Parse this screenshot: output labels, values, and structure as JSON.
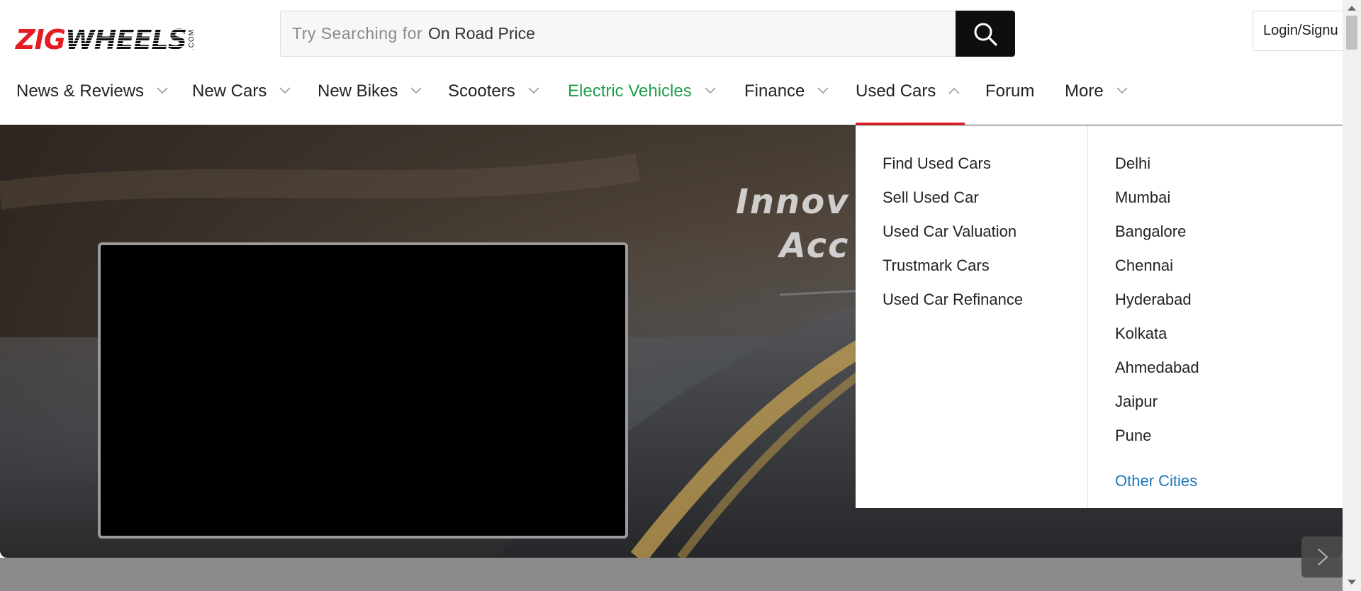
{
  "brand": {
    "logo_text_red": "ZIG",
    "logo_text_black": "WHEELS",
    "logo_suffix": ".COM"
  },
  "search": {
    "prefix": "Try Searching for",
    "value": "On Road Price",
    "icon": "search-icon"
  },
  "header": {
    "login_label": "Login/Signu"
  },
  "nav": {
    "items": [
      {
        "label": "News & Reviews",
        "has_dropdown": true
      },
      {
        "label": "New Cars",
        "has_dropdown": true
      },
      {
        "label": "New Bikes",
        "has_dropdown": true
      },
      {
        "label": "Scooters",
        "has_dropdown": true
      },
      {
        "label": "Electric Vehicles",
        "has_dropdown": true,
        "color": "#1e9e4a"
      },
      {
        "label": "Finance",
        "has_dropdown": true
      },
      {
        "label": "Used Cars",
        "has_dropdown": true,
        "active": true
      },
      {
        "label": "Forum",
        "has_dropdown": false
      },
      {
        "label": "More",
        "has_dropdown": true
      }
    ],
    "active_underline_color": "#e51b24"
  },
  "hero": {
    "tagline": "Innov\n  Acc"
  },
  "used_cars_menu": {
    "links": [
      "Find Used Cars",
      "Sell Used Car",
      "Used Car Valuation",
      "Trustmark Cars",
      "Used Car Refinance"
    ],
    "cities": [
      "Delhi",
      "Mumbai",
      "Bangalore",
      "Chennai",
      "Hyderabad",
      "Kolkata",
      "Ahmedabad",
      "Jaipur",
      "Pune"
    ],
    "other_cities": "Other Cities"
  },
  "colors": {
    "brand_red": "#e51b24",
    "ev_green": "#1e9e4a",
    "link_blue": "#1d78b8"
  }
}
